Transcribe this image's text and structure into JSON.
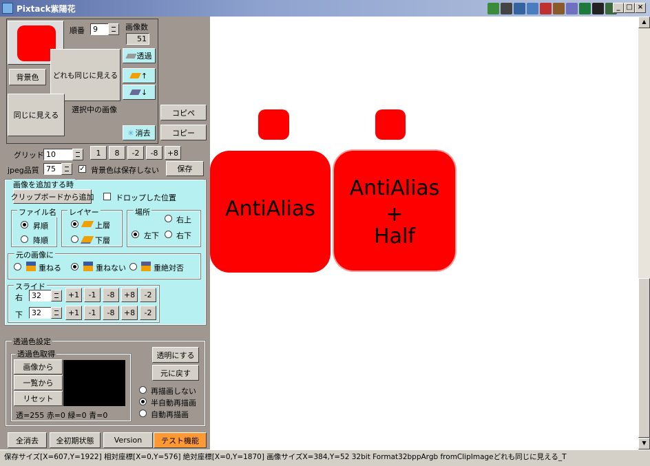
{
  "window": {
    "title": "Pixtack紫陽花"
  },
  "preview": {
    "order_label": "順番",
    "order_value": "9",
    "image_count_label": "画像数",
    "image_count_value": "51",
    "bg_color_button": "背景色",
    "label_all_same": "どれも同じに見える",
    "label_same": "同じに見える",
    "selected_image_label": "選択中の画像",
    "transparent_button": "透過",
    "up_button": "↑",
    "down_button": "↓",
    "erase_button": "消去",
    "copy_paste_button": "コピペ",
    "copy_button": "コピー"
  },
  "grid": {
    "label": "グリッド",
    "value": "10",
    "buttons": [
      "1",
      "8",
      "-2",
      "-8",
      "+8"
    ]
  },
  "jpeg": {
    "label": "jpeg品質",
    "value": "75",
    "no_save_bg_label": "背景色は保存しない",
    "save_button": "保存"
  },
  "add_image": {
    "group_title": "画像を追加する時",
    "clipboard_button": "クリップボードから追加",
    "dropped_position_label": "ドロップした位置",
    "filename": {
      "title": "ファイル名",
      "asc": "昇順",
      "desc": "降順"
    },
    "layer": {
      "title": "レイヤー",
      "top": "上層",
      "bottom": "下層"
    },
    "location": {
      "title": "場所",
      "top_right": "右上",
      "bottom_left": "左下",
      "bottom_right": "右下"
    },
    "original": {
      "title": "元の画像に",
      "overlap": "重ねる",
      "no_overlap": "重ねない",
      "never_overlap": "重絶対否"
    },
    "slide": {
      "title": "スライド",
      "right_label": "右",
      "right_value": "32",
      "down_label": "下",
      "down_value": "32",
      "buttons": [
        "+1",
        "-1",
        "-8",
        "+8",
        "-2"
      ]
    }
  },
  "transparency": {
    "group_title": "透過色設定",
    "get_title": "透過色取得",
    "from_image": "画像から",
    "from_list": "一覧から",
    "reset": "リセット",
    "values_text": "透=255 赤=0 緑=0 青=0",
    "make_transparent": "透明にする",
    "restore": "元に戻す",
    "no_redraw": "再描画しない",
    "semi_auto_redraw": "半自動再描画",
    "auto_redraw": "自動再描画"
  },
  "bottom_tabs": {
    "clear_all": "全消去",
    "init_state": "全初期状態",
    "version": "Version",
    "test": "テスト機能"
  },
  "canvas": {
    "text_left": "AntiAlias",
    "text_right_1": "AntiAlias",
    "text_right_2": "+",
    "text_right_3": "Half",
    "shape_color": "#ff0000"
  },
  "status": {
    "text": "保存サイズ[X=607,Y=1922]  相対座標[X=0,Y=576]  絶対座標[X=0,Y=1870]  画像サイズX=384,Y=52  32bit  Format32bppArgb  fromClipImageどれも同じに見える_T"
  }
}
